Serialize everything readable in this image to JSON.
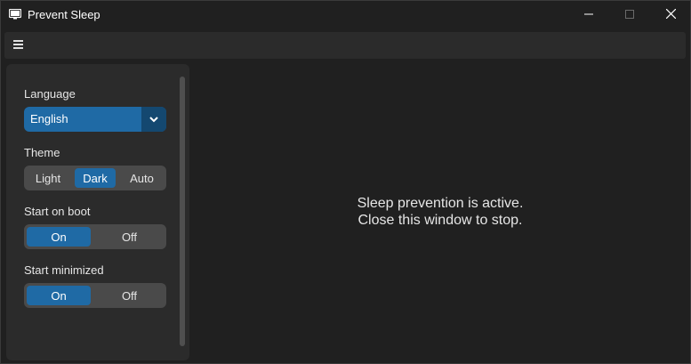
{
  "window": {
    "title": "Prevent Sleep",
    "icons": {
      "app": "monitor-icon",
      "minimize": "minimize-icon",
      "maximize": "maximize-icon",
      "close": "close-icon",
      "menu": "hamburger-menu-icon"
    }
  },
  "sidebar": {
    "language": {
      "label": "Language",
      "selected": "English"
    },
    "theme": {
      "label": "Theme",
      "options": [
        "Light",
        "Dark",
        "Auto"
      ],
      "selected": "Dark"
    },
    "start_on_boot": {
      "label": "Start on boot",
      "options": [
        "On",
        "Off"
      ],
      "selected": "On"
    },
    "start_minimized": {
      "label": "Start minimized",
      "options": [
        "On",
        "Off"
      ],
      "selected": "On"
    }
  },
  "main": {
    "status_line1": "Sleep prevention is active.",
    "status_line2": "Close this window to stop."
  },
  "colors": {
    "accent": "#1f6aa5",
    "accent_dark": "#144870",
    "background": "#202020",
    "panel": "#2b2b2b",
    "segment_bg": "#4a4a4a"
  }
}
